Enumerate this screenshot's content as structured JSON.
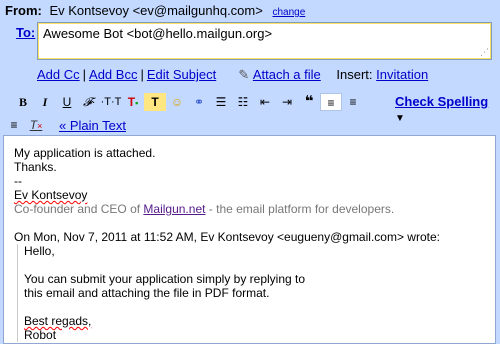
{
  "from": {
    "label": "From:",
    "value": "Ev Kontsevoy <ev@mailgunhq.com>",
    "change_link": "change"
  },
  "to": {
    "label": "To:",
    "value": "Awesome Bot <bot@hello.mailgun.org>"
  },
  "links": {
    "add_cc": "Add Cc",
    "add_bcc": "Add Bcc",
    "edit_subject": "Edit Subject",
    "attach_file": "Attach a file",
    "insert_label": "Insert:",
    "invitation": "Invitation"
  },
  "toolbar": {
    "check_spelling": "Check Spelling",
    "plain_text": "« Plain Text",
    "icons": [
      "bold",
      "italic",
      "underline",
      "font",
      "text-size",
      "text-color",
      "highlight",
      "smiley",
      "link",
      "numbered-list",
      "bulleted-list",
      "indent-less",
      "indent-more",
      "quote",
      "align-left",
      "align-center",
      "align-right",
      "remove-format"
    ]
  },
  "body": {
    "line1": "My application is attached.",
    "line2": "Thanks.",
    "line3": "--",
    "sig_name": "Ev Kontsevoy",
    "sig_line_pre": "Co-founder and CEO of ",
    "sig_brand": "Mailgun.net",
    "sig_line_post": " - the email platform for developers.",
    "quote_header": "On Mon, Nov 7, 2011 at 11:52 AM, Ev Kontsevoy <eugueny@gmail.com> wrote:",
    "q1": "Hello,",
    "q2": "You can submit your application simply by replying to",
    "q3": "this email and attaching the file in PDF format.",
    "q4": "Best regads,",
    "q5": "Robot"
  }
}
